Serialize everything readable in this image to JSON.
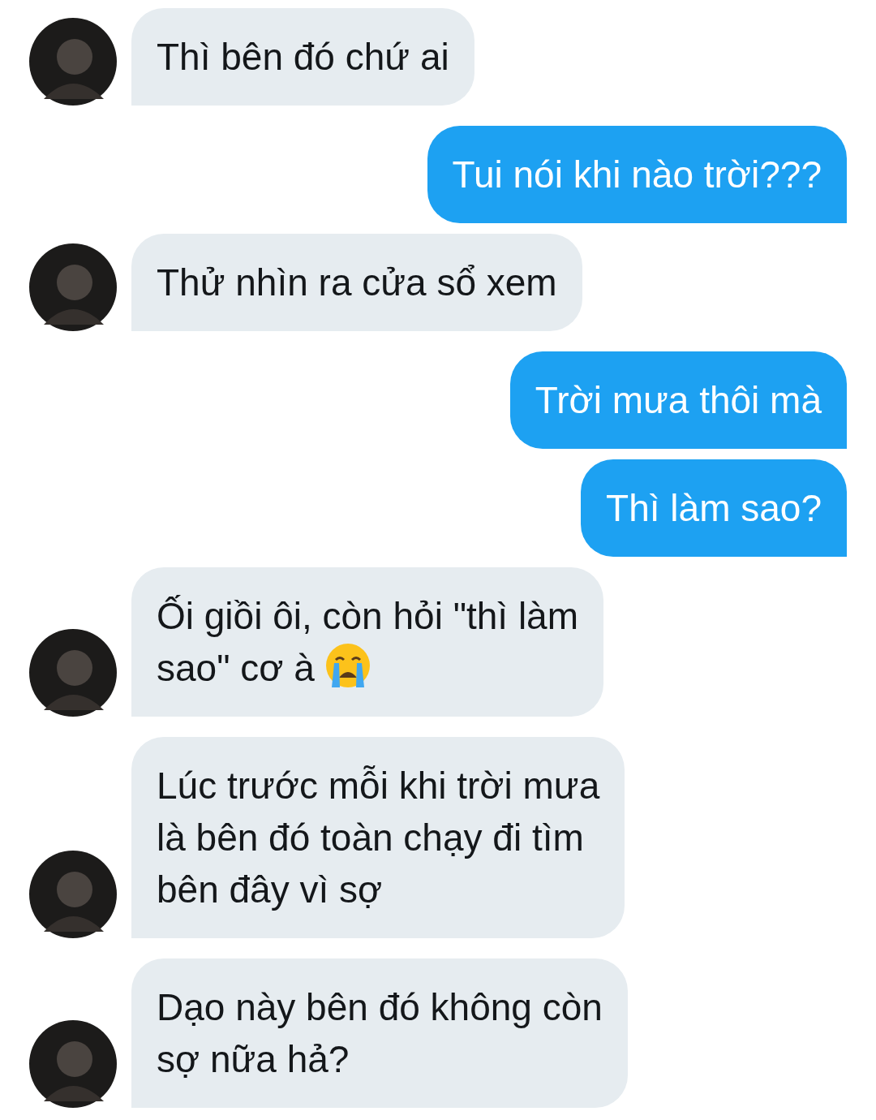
{
  "messages": [
    {
      "kind": "received",
      "lines": [
        "Thì bên đó chứ ai"
      ]
    },
    {
      "kind": "sent",
      "lines": [
        "Tui nói khi nào trời???"
      ]
    },
    {
      "kind": "received",
      "lines": [
        "Thử nhìn ra cửa sổ xem"
      ]
    },
    {
      "kind": "sent",
      "lines": [
        "Trời mưa thôi mà"
      ]
    },
    {
      "kind": "sent",
      "lines": [
        "Thì làm sao?"
      ]
    },
    {
      "kind": "received",
      "lines": [
        "Ối giồi ôi, còn hỏi \"thì làm",
        "sao\" cơ à"
      ],
      "emoji": true
    },
    {
      "kind": "received",
      "lines": [
        "Lúc trước mỗi khi trời mưa",
        "là bên đó toàn chạy đi tìm",
        "bên đây vì sợ"
      ]
    },
    {
      "kind": "received",
      "lines": [
        "Dạo này bên đó không còn",
        "sợ nữa hả?"
      ]
    }
  ]
}
